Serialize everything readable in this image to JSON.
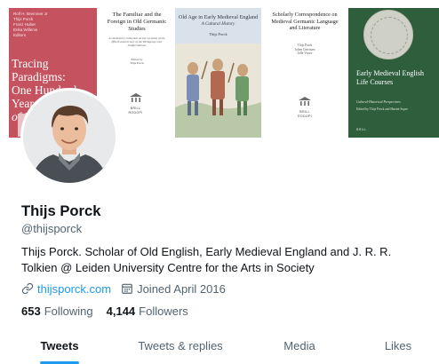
{
  "banner": {
    "books": [
      {
        "authors": [
          "Rolf H. Bremmer Jr",
          "Thijs Porck",
          "Franz Huber",
          "Erika Willems"
        ],
        "authors_role": "Editors",
        "title_lines": [
          "Tracing Paradigms:",
          "One Hundred Years"
        ],
        "title_italic": "of Neophilologus"
      },
      {
        "title": "The Familiar and the Foreign in Old Germanic Studies",
        "subtitle": "A celebratory collection on the occasion of the fiftieth anniversary of the Werkgroep voor Oudgermaanse",
        "editor_label": "Edited by",
        "editor": "Thijs Porck"
      },
      {
        "title": "Old Age in Early Medieval England",
        "subtitle": "A Cultural History",
        "author": "Thijs Porck"
      },
      {
        "title": "Scholarly Correspondence on Medieval Germanic Language and Literature",
        "editors": [
          "Thijs Porck",
          "Jolien Gerritsen",
          "Jelle Visser"
        ]
      },
      {
        "title": "Early Medieval English Life Courses",
        "subtitle": "Cultural-Historical Perspectives",
        "editors": "Edited by Thijs Porck and Harriet Soper"
      }
    ],
    "publisher": "BRILL",
    "publisher_2": "RODOPI"
  },
  "profile": {
    "name": "Thijs Porck",
    "handle": "@thijsporck",
    "bio": "Thijs Porck. Scholar of Old English, Early Medieval England and J. R. R. Tolkien @ Leiden University Centre for the Arts in Society",
    "website": "thijsporck.com",
    "joined": "Joined April 2016",
    "following_count": "653",
    "following_label": "Following",
    "followers_count": "4,144",
    "followers_label": "Followers"
  },
  "tabs": [
    {
      "label": "Tweets",
      "active": true
    },
    {
      "label": "Tweets & replies",
      "active": false
    },
    {
      "label": "Media",
      "active": false
    },
    {
      "label": "Likes",
      "active": false
    }
  ],
  "colors": {
    "accent": "#1d9bf0",
    "text": "#0f1419",
    "secondary": "#536471"
  },
  "icons": {
    "website": "link-icon",
    "joined": "calendar-icon"
  }
}
